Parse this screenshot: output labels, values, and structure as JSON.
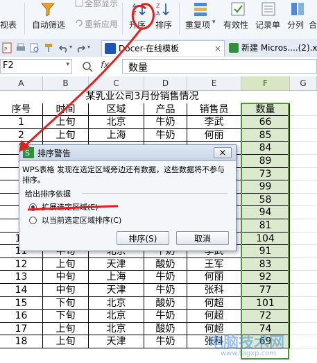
{
  "ribbon": {
    "view_label": "视表",
    "filter_auto_label": "自动筛选",
    "show_all_label": "全部显示",
    "reapply_label": "重新应用",
    "sort_asc_label": "升序",
    "sort_desc_label": "排序",
    "duplicates_label": "重复项",
    "validity_label": "有效性",
    "records_label": "记录单",
    "split_label": "分列",
    "more_label": "合"
  },
  "tabs": [
    {
      "label": "Docer-在线模板"
    },
    {
      "label": "新建 Micros....(2).x"
    }
  ],
  "formula_bar": {
    "cell_ref": "F2",
    "fx": "fx",
    "value": "数量"
  },
  "columns": [
    "A",
    "B",
    "C",
    "D",
    "E",
    "F",
    "G"
  ],
  "sheet": {
    "title": "某乳业公司3月份销售情况",
    "headers": [
      "序号",
      "时间",
      "区域",
      "产品",
      "销售员",
      "数量"
    ],
    "rows": [
      [
        "1",
        "上旬",
        "北京",
        "牛奶",
        "李武",
        "66"
      ],
      [
        "2",
        "上旬",
        "上海",
        "牛奶",
        "何丽",
        "85"
      ],
      [
        "3",
        "",
        "",
        "",
        "",
        "84"
      ],
      [
        "4",
        "",
        "",
        "",
        "",
        "89"
      ],
      [
        "5",
        "",
        "",
        "",
        "",
        "73"
      ],
      [
        "6",
        "",
        "",
        "",
        "",
        "99"
      ],
      [
        "7",
        "",
        "",
        "",
        "",
        "58"
      ],
      [
        "8",
        "",
        "",
        "",
        "",
        "94"
      ],
      [
        "9",
        "",
        "",
        "",
        "",
        "81"
      ],
      [
        "10",
        "",
        "",
        "",
        "",
        "104"
      ],
      [
        "11",
        "中旬",
        "北京",
        "牛奶",
        "李武",
        "91"
      ],
      [
        "12",
        "上旬",
        "天津",
        "酸奶",
        "王军",
        "83"
      ],
      [
        "13",
        "中旬",
        "上海",
        "牛奶",
        "何丽",
        "92"
      ],
      [
        "14",
        "中旬",
        "天津",
        "牛奶",
        "张科",
        "77"
      ],
      [
        "15",
        "下旬",
        "北京",
        "酸奶",
        "何超",
        "101"
      ],
      [
        "16",
        "下旬",
        "北京",
        "牛奶",
        "何超",
        "72"
      ],
      [
        "17",
        "上旬",
        "北京",
        "酸奶",
        "何超",
        "74"
      ],
      [
        "18",
        "上旬",
        "天津",
        "牛奶",
        "张科",
        "69"
      ]
    ]
  },
  "dialog": {
    "title": "排序警告",
    "message": "WPS表格 发现在选定区域旁边还有数据，这些数据将不参与排序。",
    "group_label": "给出排序依据",
    "option_expand": "扩展选定区域(E)",
    "option_current": "以当前选定区域排序(C)",
    "sort_button": "排序(S)",
    "cancel_button": "取消",
    "close": "×"
  },
  "watermark": {
    "text": "电脑技术网",
    "url": "www.tagxp.com"
  },
  "colors": {
    "annotation_red": "#e0201e",
    "selection_green": "#4e9a2e",
    "selection_fill": "#dbeacd"
  }
}
